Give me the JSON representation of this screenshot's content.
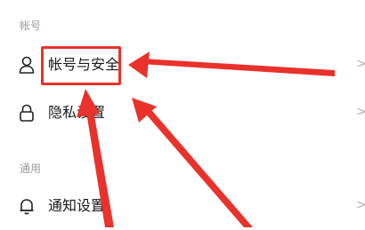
{
  "sections": [
    {
      "title": "帐号"
    },
    {
      "title": "通用"
    }
  ],
  "items": [
    {
      "label": "帐号与安全",
      "icon": "person-icon",
      "chevron": ">"
    },
    {
      "label": "隐私设置",
      "icon": "lock-icon",
      "chevron": ">"
    },
    {
      "label": "通知设置",
      "icon": "bell-icon",
      "chevron": ">"
    }
  ],
  "colors": {
    "annotation": "#e8322b",
    "section_title": "#9a9a9a",
    "text": "#1a1a1a",
    "chevron": "#b0b0b0"
  }
}
